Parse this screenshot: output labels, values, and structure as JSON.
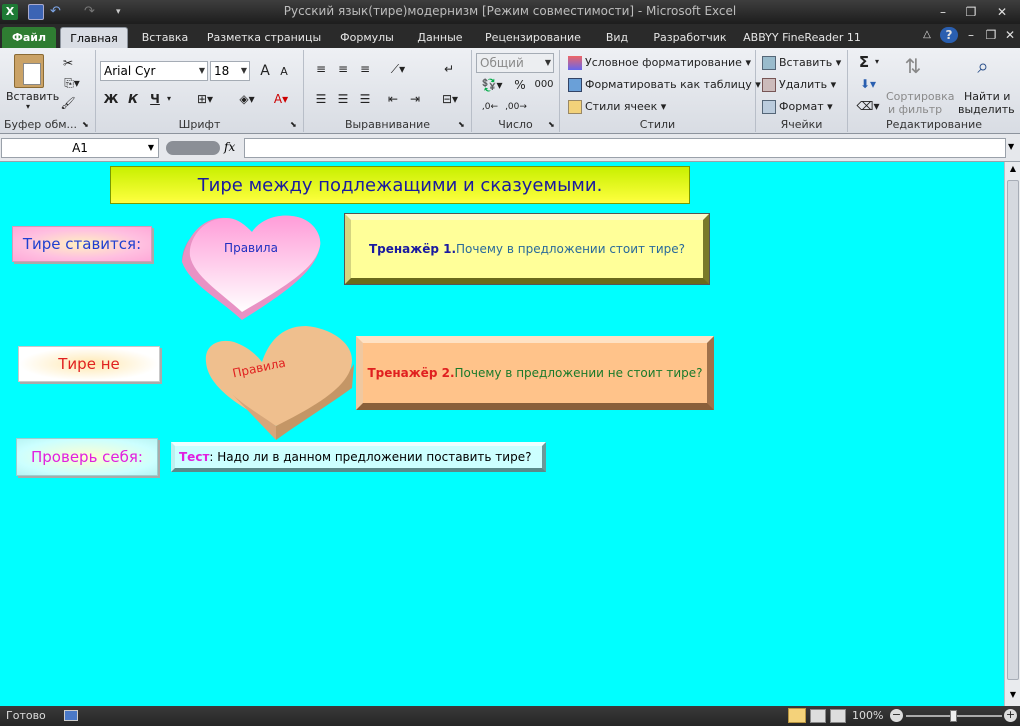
{
  "window": {
    "title": "Русский язык(тире)модернизм  [Режим совместимости]  -  Microsoft Excel"
  },
  "tabs": [
    {
      "label": "Файл"
    },
    {
      "label": "Главная"
    },
    {
      "label": "Вставка"
    },
    {
      "label": "Разметка страницы"
    },
    {
      "label": "Формулы"
    },
    {
      "label": "Данные"
    },
    {
      "label": "Рецензирование"
    },
    {
      "label": "Вид"
    },
    {
      "label": "Разработчик"
    },
    {
      "label": "ABBYY FineReader 11"
    }
  ],
  "ribbon": {
    "clipboard": {
      "paste": "Вставить",
      "label": "Буфер обм..."
    },
    "font": {
      "name": "Arial Cyr",
      "size": "18",
      "bold": "Ж",
      "italic": "К",
      "underline": "Ч",
      "grow": "A",
      "shrink": "A",
      "label": "Шрифт"
    },
    "alignment": {
      "label": "Выравнивание"
    },
    "number": {
      "format": "Общий",
      "percent": "%",
      "thousands": "000",
      "label": "Число"
    },
    "styles": {
      "conditional": "Условное форматирование",
      "table": "Форматировать как таблицу",
      "cell": "Стили ячеек",
      "label": "Стили"
    },
    "cells": {
      "insert": "Вставить",
      "delete": "Удалить",
      "format": "Формат",
      "label": "Ячейки"
    },
    "editing": {
      "sum": "Σ",
      "sort": "Сортировка",
      "sort2": "и фильтр",
      "find": "Найти и",
      "find2": "выделить",
      "label": "Редактирование"
    }
  },
  "formula_bar": {
    "name_box": "A1",
    "fx": "fx",
    "value": ""
  },
  "sheet": {
    "title": "Тире между подлежащими  и сказуемыми.",
    "box1": "Тире  ставится:",
    "heart1": "Правила",
    "trainer1_bold": "Тренажёр 1.",
    "trainer1_text": " Почему  в предложении   стоит  тире?",
    "box2": "Тире  не",
    "heart2": "Правила",
    "trainer2_bold": "Тренажёр 2.",
    "trainer2_text": " Почему  в предложении   не стоит  тире?",
    "box3": "Проверь себя:",
    "test_bold": "Тест",
    "test_text": " :  Надо ли в данном  предложении   поставить  тире?"
  },
  "status": {
    "ready": "Готово",
    "zoom": "100%"
  },
  "colors": {
    "sheet_bg": "#00ffff",
    "file_tab": "#2f7d32"
  }
}
